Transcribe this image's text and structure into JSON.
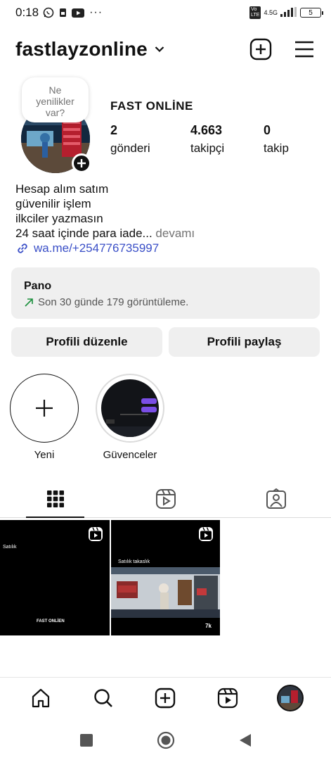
{
  "status_bar": {
    "time": "0:18",
    "network": "4.5G",
    "battery": "5"
  },
  "header": {
    "username": "fastlayzonline"
  },
  "profile": {
    "note": "Ne yenilikler var?",
    "display_name": "FAST ONLİNE",
    "stats": [
      {
        "value": "2",
        "label": "gönderi"
      },
      {
        "value": "4.663",
        "label": "takipçi"
      },
      {
        "value": "0",
        "label": "takip"
      }
    ],
    "bio_lines": [
      "Hesap alım satım",
      "güvenilir işlem",
      "ilkciler yazmasın",
      "24 saat içinde para iade..."
    ],
    "bio_more": " devamı",
    "link": "wa.me/+254776735997"
  },
  "dashboard": {
    "title": "Pano",
    "subtitle": "Son 30 günde 179 görüntüleme."
  },
  "buttons": {
    "edit_profile": "Profili düzenle",
    "share_profile": "Profili paylaş"
  },
  "highlights": [
    {
      "label": "Yeni"
    },
    {
      "label": "Güvenceler"
    }
  ],
  "posts": [
    {
      "caption_top": "Satılık",
      "caption_bottom": "FAST ONLİEN"
    },
    {
      "caption_top": "Satılık takaslık",
      "views": "7k"
    }
  ],
  "colors": {
    "link": "#3a4fc7",
    "card_bg": "#efefef",
    "trend_arrow": "#1a8f3c"
  }
}
